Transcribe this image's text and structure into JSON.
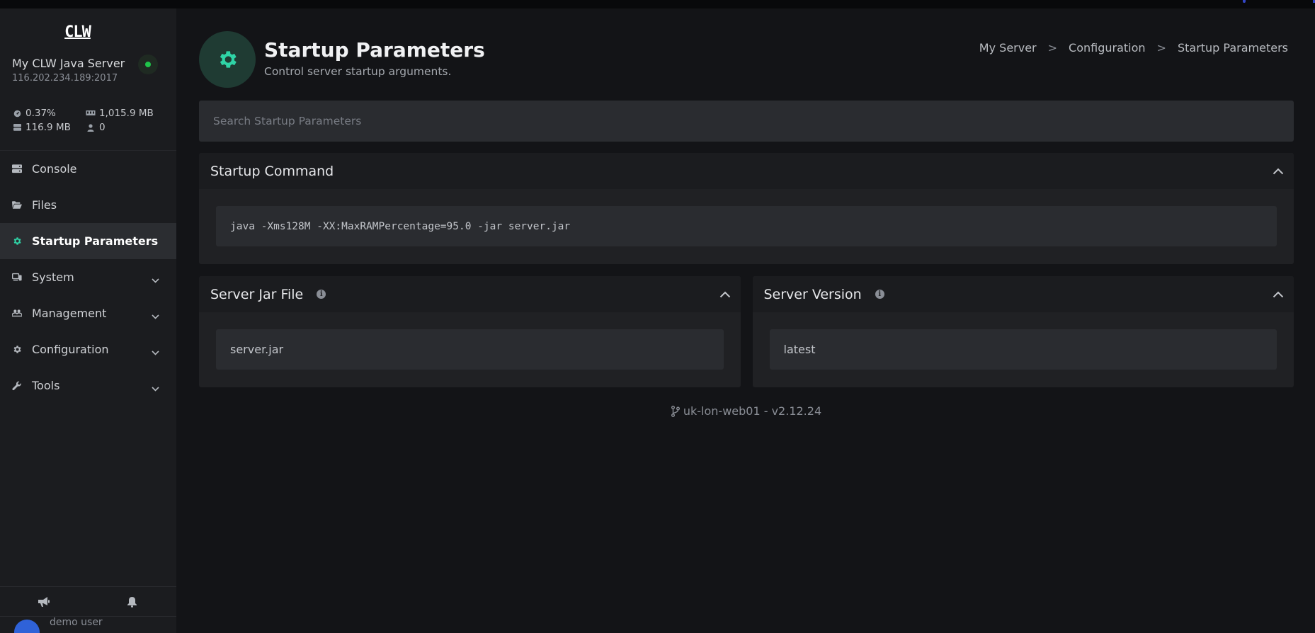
{
  "app": {
    "logo_text": "CLW",
    "accent_color": "#2fd3a6",
    "online_color": "#1fc44a"
  },
  "server": {
    "name": "My CLW Java Server",
    "address": "116.202.234.189:2017",
    "status": "online",
    "stats": {
      "cpu": "0.37%",
      "memory": "1,015.9 MB",
      "disk": "116.9 MB",
      "players": "0"
    }
  },
  "sidebar": {
    "items": [
      {
        "label": "Console",
        "icon": "server-icon",
        "active": false,
        "expandable": false
      },
      {
        "label": "Files",
        "icon": "folder-open-icon",
        "active": false,
        "expandable": false
      },
      {
        "label": "Startup Parameters",
        "icon": "gear-icon",
        "active": true,
        "expandable": false
      },
      {
        "label": "System",
        "icon": "devices-icon",
        "active": false,
        "expandable": true
      },
      {
        "label": "Management",
        "icon": "users-gear-icon",
        "active": false,
        "expandable": true
      },
      {
        "label": "Configuration",
        "icon": "gear-icon",
        "active": false,
        "expandable": true
      },
      {
        "label": "Tools",
        "icon": "wrench-icon",
        "active": false,
        "expandable": true
      }
    ],
    "bottom_icons": [
      "megaphone-icon",
      "bell-icon"
    ],
    "user": {
      "name": "demo user"
    }
  },
  "header": {
    "title": "Startup Parameters",
    "subtitle": "Control server startup arguments.",
    "breadcrumb": [
      "My Server",
      "Configuration",
      "Startup Parameters"
    ],
    "breadcrumb_separator": ">"
  },
  "search": {
    "placeholder": "Search Startup Parameters",
    "value": ""
  },
  "cards": {
    "startup_command": {
      "title": "Startup Command",
      "value": "java -Xms128M -XX:MaxRAMPercentage=95.0 -jar server.jar"
    },
    "server_jar": {
      "title": "Server Jar File",
      "value": "server.jar"
    },
    "server_version": {
      "title": "Server Version",
      "value": "latest"
    }
  },
  "footer": {
    "text": "uk-lon-web01 - v2.12.24",
    "icon": "code-branch-icon"
  }
}
